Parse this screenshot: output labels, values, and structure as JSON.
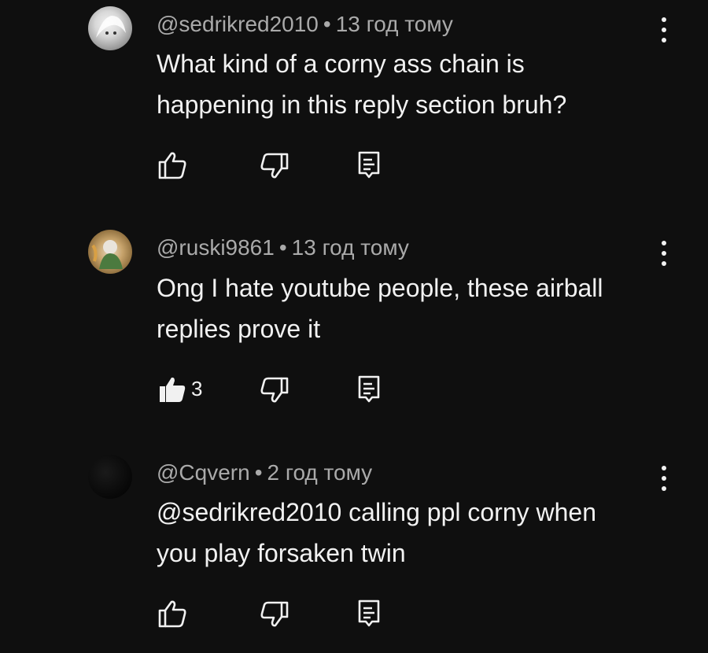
{
  "comments": [
    {
      "author": "@sedrikred2010",
      "separator": "•",
      "time": "13 год тому",
      "lines": [
        "What kind of a corny ass chain is",
        "happening in this reply section bruh?"
      ],
      "likes": "",
      "liked": false,
      "icons": {
        "like": "thumb-up-outline-icon",
        "dislike": "thumb-down-outline-icon",
        "reply": "reply-icon",
        "menu": "more-vert-icon"
      }
    },
    {
      "author": "@ruski9861",
      "separator": "•",
      "time": "13 год тому",
      "lines": [
        "Ong I hate youtube people, these airball",
        "replies prove it"
      ],
      "likes": "3",
      "liked": true,
      "icons": {
        "like": "thumb-up-filled-icon",
        "dislike": "thumb-down-outline-icon",
        "reply": "reply-icon",
        "menu": "more-vert-icon"
      }
    },
    {
      "author": "@Cqvern",
      "separator": "•",
      "time": "2 год тому",
      "lines": [
        "@sedrikred2010 calling ppl corny when",
        "you play forsaken twin"
      ],
      "likes": "",
      "liked": false,
      "icons": {
        "like": "thumb-up-outline-icon",
        "dislike": "thumb-down-outline-icon",
        "reply": "reply-icon",
        "menu": "more-vert-icon"
      }
    }
  ],
  "colors": {
    "background": "#0f0f0f",
    "text": "#f1f1f1",
    "meta": "#aaaaaa"
  }
}
